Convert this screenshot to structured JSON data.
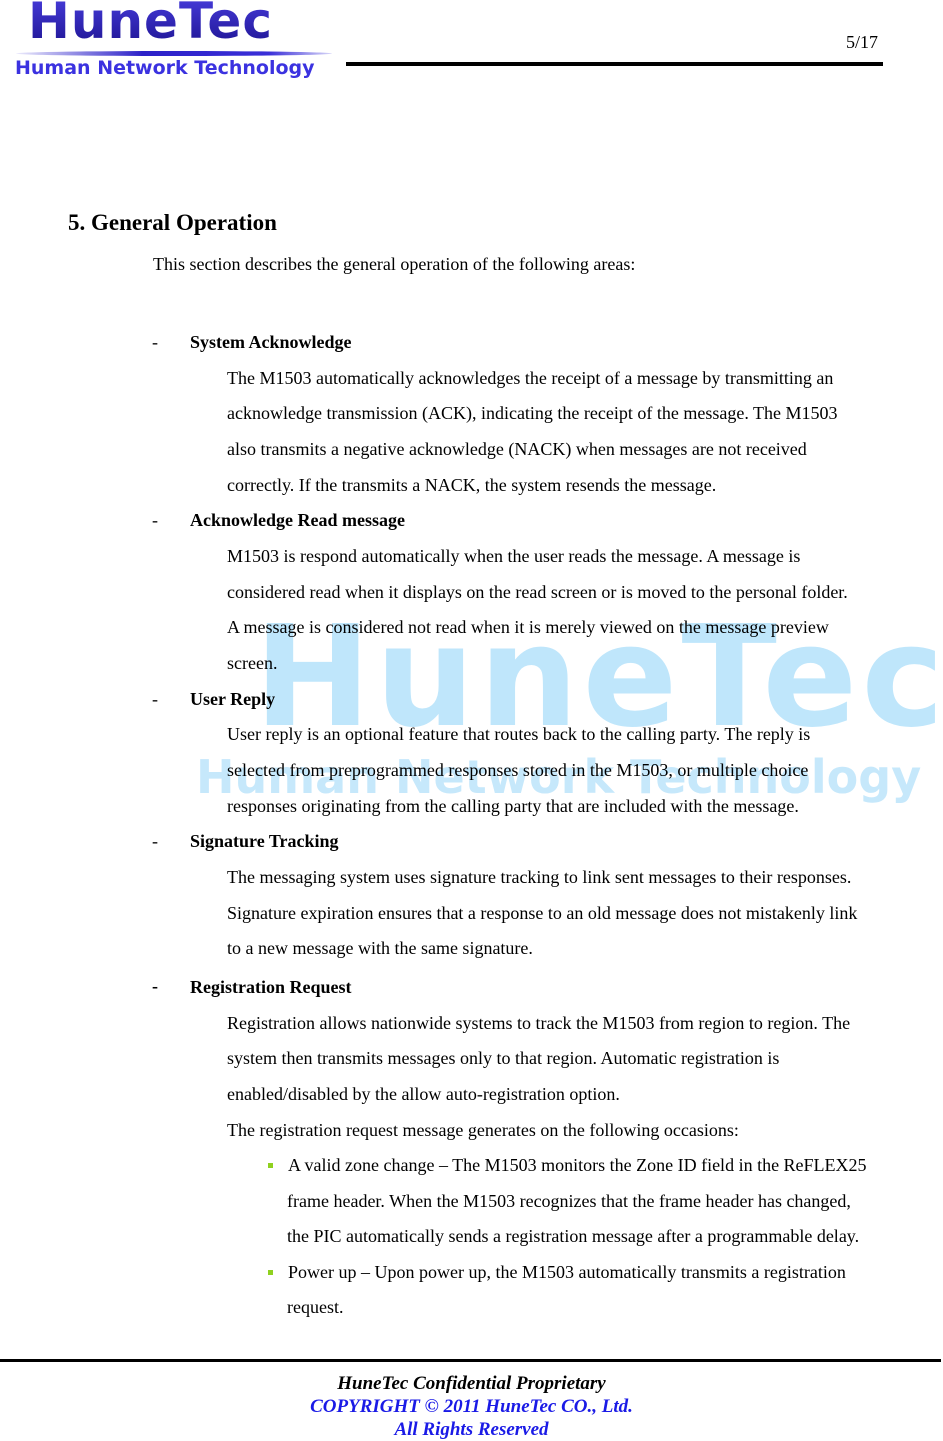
{
  "header": {
    "logo_main": "HuneTec",
    "logo_sub": "Human Network Technology",
    "page_number": "5/17"
  },
  "watermark": {
    "main": "HuneTec",
    "sub": "Human Network Technology"
  },
  "section": {
    "heading": "5.  General Operation",
    "intro": "This section describes the general operation of the following areas:",
    "items": [
      {
        "dash": "-",
        "title": "System Acknowledge",
        "lines": [
          "The M1503 automatically acknowledges the receipt of a message by transmitting an",
          "acknowledge transmission (ACK), indicating the receipt of the message. The M1503",
          "also transmits a negative acknowledge (NACK) when messages are not received",
          "correctly. If the transmits a NACK, the system resends the message."
        ]
      },
      {
        "dash": "-",
        "title": "Acknowledge Read message",
        "lines": [
          "M1503 is respond automatically when the user reads the message. A message is",
          "considered read when it displays on the read screen or is moved to the personal folder.",
          "A message is considered not read when it is merely viewed on the message preview",
          "screen."
        ]
      },
      {
        "dash": "-",
        "title": "User Reply",
        "lines": [
          "User reply is an optional feature that routes back to the calling party. The reply is",
          "selected from preprogrammed responses stored in the M1503, or multiple choice",
          "responses originating from the calling party that are included with the message."
        ]
      },
      {
        "dash": "-",
        "title": "Signature Tracking",
        "lines": [
          "The messaging system uses signature tracking to link sent messages to their responses.",
          "Signature expiration ensures that a response to an old message does not mistakenly link",
          "to a new message with the same signature."
        ]
      },
      {
        "dash": "-",
        "title": "Registration Request",
        "lines": [
          "Registration allows nationwide systems to track the M1503 from region to region. The",
          "system then transmits messages only to that region. Automatic registration is",
          "enabled/disabled by the allow auto-registration option.",
          "The registration request message generates on the following occasions:"
        ],
        "bullets": [
          {
            "lines": [
              "A valid zone change – The M1503 monitors the Zone ID field in the ReFLEX25",
              "frame header. When the M1503 recognizes that the frame header has changed,",
              "the PIC automatically sends a registration message after a programmable delay."
            ]
          },
          {
            "lines": [
              "Power up – Upon power up, the M1503 automatically transmits a registration",
              "request."
            ]
          }
        ]
      }
    ]
  },
  "footer": {
    "line1": "HuneTec Confidential Proprietary",
    "line2": "COPYRIGHT © 2011 HuneTec CO., Ltd.",
    "line3": "All Rights Reserved"
  },
  "colors": {
    "logo_blue": "#2a1fb8",
    "watermark_blue": "#bfe6fb",
    "bullet_green": "#8fd11f",
    "footer_blue": "#1a1ae6"
  }
}
